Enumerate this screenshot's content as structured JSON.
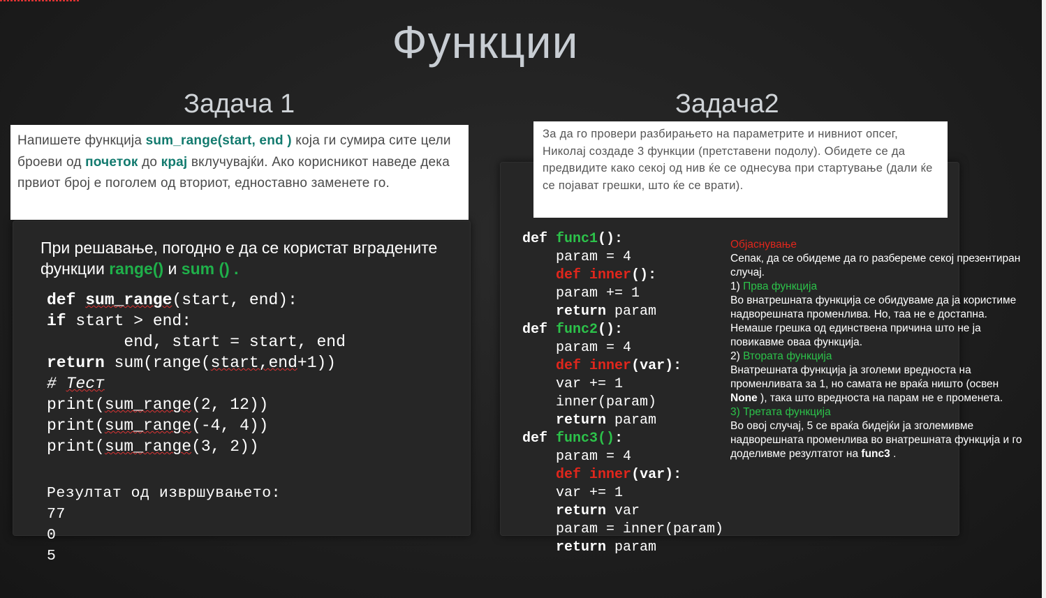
{
  "title": "Функции",
  "task1": {
    "heading": "Задача 1",
    "card": {
      "p1": "Напишете функција ",
      "b1": "sum_range(start, end )",
      "p2": " која ги сумира сите цели броеви од ",
      "b2": "почеток",
      "p3": " до ",
      "b3": "крај",
      "p4": " вклучувајќи. Ако корисникот наведе дека првиот број е поголем од вториот, едноставно заменете го."
    },
    "hint": {
      "p1": "При решавање, погодно е да се користат вградените функции ",
      "g1": "range()",
      "p2": " и ",
      "g2": "sum ()",
      "p3": " ."
    },
    "code": {
      "l1_kw": "def ",
      "l1_fn": "sum_range",
      "l1_rest": "(start, end):",
      "l2_kw": "if",
      "l2_rest": " start > end:",
      "l3": "        end, start = start, end",
      "l4_kw": "return",
      "l4_rest": " sum(range(",
      "l4_sq": "start,end",
      "l4_end": "+1))",
      "l5_a": "# ",
      "l5_b": "Тест",
      "l6_a": "print(",
      "l6_sq": "sum_range",
      "l6_b": "(2, 12))",
      "l7_a": "print(",
      "l7_sq": "sum_range",
      "l7_b": "(-4, 4))",
      "l8_a": "print(",
      "l8_sq": "sum_range",
      "l8_b": "(3, 2))"
    },
    "output": {
      "label": "Резултат од извршувањето:",
      "v1": "77",
      "v2": "0",
      "v3": "5"
    }
  },
  "task2": {
    "heading": "Задача2",
    "card": "За да го провери разбирањето на параметрите и нивниот опсег, Николај создаде 3 функции (претставени подолу). Обидете се да предвидите како секој од нив ќе се однесува при стартување (дали ќе се појават грешки, што ќе се врати).",
    "code": {
      "def": "def",
      "func1": "func1",
      "func2": "func2",
      "func3": "func3",
      "inner": "inner",
      "paren_empty": "():",
      "func3_paren": "()",
      "colon": ":",
      "inner_var": "(var):",
      "param4": "    param = 4",
      "param_inc": "    param += 1",
      "var_inc": "    var += 1",
      "ret": "return",
      "ret_param": " param",
      "ret_var": " var",
      "inner_call": "    inner(param)",
      "assign": "    param = inner(param)",
      "indent": "    "
    },
    "explanation": {
      "heading": "Објаснување",
      "intro": "Сепак, да се обидеме да го разбереме секој презентиран случај.",
      "n1": "1) ",
      "h1": "Прва функција",
      "t1": "Во внатрешната функција се обидуваме да ја користиме надворешната променлива. Но, таа не е достапна. Немаше грешка од единствена причина што не ја повикавме оваа функција.",
      "n2": "2) ",
      "h2": "Втората функција",
      "t2a": "Внатрешната функција ја зголеми вредноста на променливата за 1, но самата не враќа ништо (освен ",
      "t2b": "None",
      "t2c": " ), така што вредноста на парам не е променета.",
      "h3": "3) Третата функција",
      "t3a": "Во овој случај, 5 се враќа бидејќи ја зголемивме надворешната променлива во внатрешната функција и го доделивме резултатот на ",
      "t3b": "func3",
      "t3c": " ."
    }
  }
}
